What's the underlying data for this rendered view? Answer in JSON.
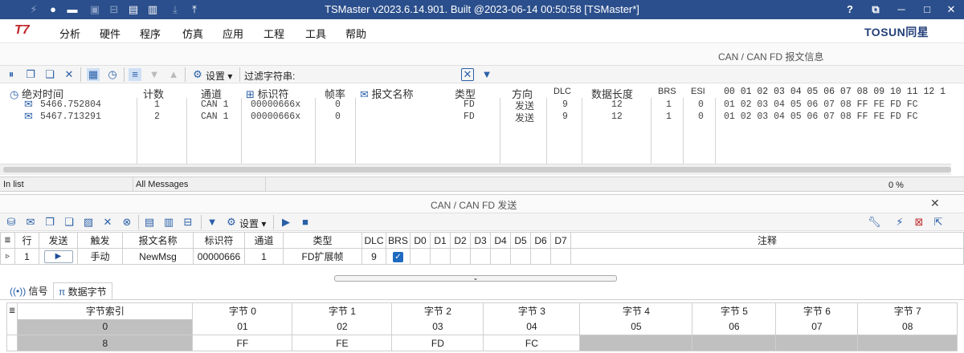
{
  "window": {
    "title": "TSMaster v2023.6.14.901. Built @2023-06-14 00:50:58 [TSMaster*]",
    "controls": [
      "?",
      "⧉",
      "─",
      "□",
      "✕"
    ]
  },
  "menu": {
    "logo_left": "T7",
    "logo_right": "TOSUN同星",
    "items": [
      "分析",
      "硬件",
      "程序",
      "仿真",
      "应用",
      "工程",
      "工具",
      "帮助"
    ]
  },
  "rx_panel": {
    "header": "CAN / CAN FD 报文信息",
    "toolbar": {
      "settings_label": "设置",
      "filter_label": "过滤字符串:",
      "filter_value": ""
    },
    "columns": [
      "绝对时间",
      "计数",
      "通道",
      "标识符",
      "帧率",
      "报文名称",
      "类型",
      "方向",
      "DLC",
      "数据长度",
      "BRS",
      "ESI",
      "00 01 02 03 04 05 06 07 08 09 10 11 12 1"
    ],
    "rows": [
      {
        "time": "5466.752804",
        "count": "1",
        "channel": "CAN 1",
        "id": "00000666x",
        "rate": "0",
        "name": "",
        "type": "FD",
        "dir": "发送",
        "dlc": "9",
        "len": "12",
        "brs": "1",
        "esi": "0",
        "data": "01 02 03 04 05 06 07 08 FF FE FD FC"
      },
      {
        "time": "5467.713291",
        "count": "2",
        "channel": "CAN 1",
        "id": "00000666x",
        "rate": "0",
        "name": "",
        "type": "FD",
        "dir": "发送",
        "dlc": "9",
        "len": "12",
        "brs": "1",
        "esi": "0",
        "data": "01 02 03 04 05 06 07 08 FF FE FD FC"
      }
    ],
    "status": {
      "left": "In list",
      "mid": "All Messages",
      "right": "0 %"
    }
  },
  "tx_panel": {
    "header": "CAN / CAN FD 发送",
    "close": "✕",
    "toolbar": {
      "settings_label": "设置"
    },
    "columns": [
      "行",
      "发送",
      "触发",
      "报文名称",
      "标识符",
      "通道",
      "类型",
      "DLC",
      "BRS",
      "D0",
      "D1",
      "D2",
      "D3",
      "D4",
      "D5",
      "D6",
      "D7",
      "注释"
    ],
    "row": {
      "line": "1",
      "trigger": "手动",
      "name": "NewMsg",
      "id": "00000666",
      "channel": "1",
      "type": "FD扩展帧",
      "dlc": "9",
      "brs_checked": true,
      "comment": ""
    },
    "tabs": [
      {
        "label": "信号",
        "icon": "signal-icon"
      },
      {
        "label": "数据字节",
        "icon": "pi-icon"
      }
    ],
    "bytes_table": {
      "headers": [
        "字节索引",
        "字节 0",
        "字节 1",
        "字节 2",
        "字节 3",
        "字节 4",
        "字节 5",
        "字节 6",
        "字节 7"
      ],
      "rows": [
        [
          "0",
          "01",
          "02",
          "03",
          "04",
          "05",
          "06",
          "07",
          "08"
        ],
        [
          "8",
          "FF",
          "FE",
          "FD",
          "FC",
          "",
          "",
          "",
          ""
        ]
      ]
    }
  },
  "colors": {
    "titlebar": "#2b4f8c",
    "accent": "#2a5fa8",
    "grey_cell": "#c0c0c0"
  }
}
